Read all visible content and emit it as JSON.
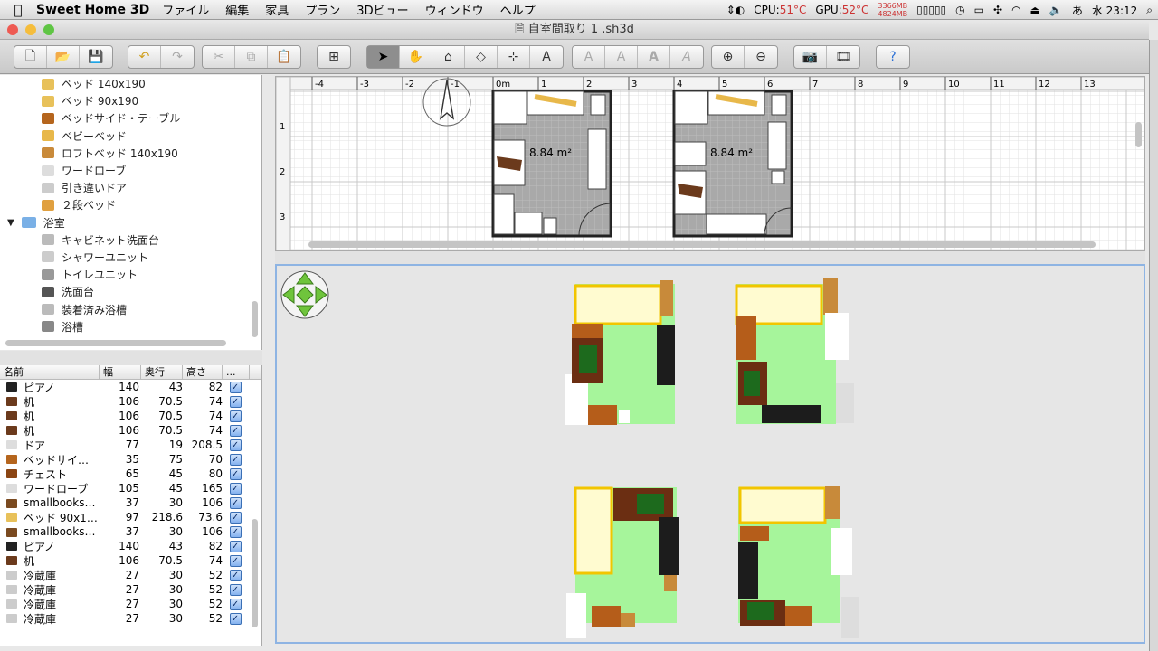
{
  "menubar": {
    "app_name": "Sweet Home 3D",
    "menus": [
      "ファイル",
      "編集",
      "家具",
      "プラン",
      "3Dビュー",
      "ウィンドウ",
      "ヘルプ"
    ],
    "cpu_label": "CPU:",
    "cpu_temp": "51°C",
    "gpu_label": "GPU:",
    "gpu_temp": "52°C",
    "mem_used": "3366MB",
    "mem_free": "4824MB",
    "input_method": "あ",
    "clock": "水 23:12"
  },
  "window": {
    "title": "自室間取り 1 .sh3d"
  },
  "catalog": {
    "items": [
      {
        "label": "ベッド 140x190",
        "color": "#e8c15a"
      },
      {
        "label": "ベッド 90x190",
        "color": "#e8c15a"
      },
      {
        "label": "ベッドサイド・テーブル",
        "color": "#b5651d"
      },
      {
        "label": "ベビーベッド",
        "color": "#e8b84a"
      },
      {
        "label": "ロフトベッド 140x190",
        "color": "#c98a3a"
      },
      {
        "label": "ワードローブ",
        "color": "#dddddd"
      },
      {
        "label": "引き違いドア",
        "color": "#cccccc"
      },
      {
        "label": "２段ベッド",
        "color": "#e0a040"
      }
    ],
    "folder": {
      "label": "浴室"
    },
    "bath_items": [
      {
        "label": "キャビネット洗面台",
        "color": "#bbbbbb"
      },
      {
        "label": "シャワーユニット",
        "color": "#cccccc"
      },
      {
        "label": "トイレユニット",
        "color": "#999999"
      },
      {
        "label": "洗面台",
        "color": "#555555"
      },
      {
        "label": "装着済み浴槽",
        "color": "#bbbbbb"
      },
      {
        "label": "浴槽",
        "color": "#888888"
      }
    ]
  },
  "furniture_table": {
    "headers": {
      "name": "名前",
      "width": "幅",
      "depth": "奥行",
      "height": "高さ",
      "more": "..."
    },
    "rows": [
      {
        "name": "ピアノ",
        "w": "140",
        "d": "43",
        "h": "82",
        "color": "#222222"
      },
      {
        "name": "机",
        "w": "106",
        "d": "70.5",
        "h": "74",
        "color": "#6b3a1c"
      },
      {
        "name": "机",
        "w": "106",
        "d": "70.5",
        "h": "74",
        "color": "#6b3a1c"
      },
      {
        "name": "机",
        "w": "106",
        "d": "70.5",
        "h": "74",
        "color": "#6b3a1c"
      },
      {
        "name": "ドア",
        "w": "77",
        "d": "19",
        "h": "208.5",
        "color": "#dddddd"
      },
      {
        "name": "ベッドサイ…",
        "w": "35",
        "d": "75",
        "h": "70",
        "color": "#b5651d"
      },
      {
        "name": "チェスト",
        "w": "65",
        "d": "45",
        "h": "80",
        "color": "#8b4513"
      },
      {
        "name": "ワードローブ",
        "w": "105",
        "d": "45",
        "h": "165",
        "color": "#dddddd"
      },
      {
        "name": "smallbooks…",
        "w": "37",
        "d": "30",
        "h": "106",
        "color": "#7a4a20"
      },
      {
        "name": "ベッド 90x1…",
        "w": "97",
        "d": "218.6",
        "h": "73.6",
        "color": "#e8c15a"
      },
      {
        "name": "smallbooks…",
        "w": "37",
        "d": "30",
        "h": "106",
        "color": "#7a4a20"
      },
      {
        "name": "ピアノ",
        "w": "140",
        "d": "43",
        "h": "82",
        "color": "#222222"
      },
      {
        "name": "机",
        "w": "106",
        "d": "70.5",
        "h": "74",
        "color": "#6b3a1c"
      },
      {
        "name": "冷蔵庫",
        "w": "27",
        "d": "30",
        "h": "52",
        "color": "#cccccc"
      },
      {
        "name": "冷蔵庫",
        "w": "27",
        "d": "30",
        "h": "52",
        "color": "#cccccc"
      },
      {
        "name": "冷蔵庫",
        "w": "27",
        "d": "30",
        "h": "52",
        "color": "#cccccc"
      },
      {
        "name": "冷蔵庫",
        "w": "27",
        "d": "30",
        "h": "52",
        "color": "#cccccc"
      }
    ]
  },
  "plan": {
    "ruler_x": [
      "-4",
      "-3",
      "-2",
      "-1",
      "0m",
      "1",
      "2",
      "3",
      "4",
      "5",
      "6",
      "7",
      "8",
      "9",
      "10",
      "11",
      "12",
      "13"
    ],
    "ruler_y": [
      "1",
      "2",
      "3"
    ],
    "room1_area": "8.84 m²",
    "room2_area": "8.84 m²"
  }
}
